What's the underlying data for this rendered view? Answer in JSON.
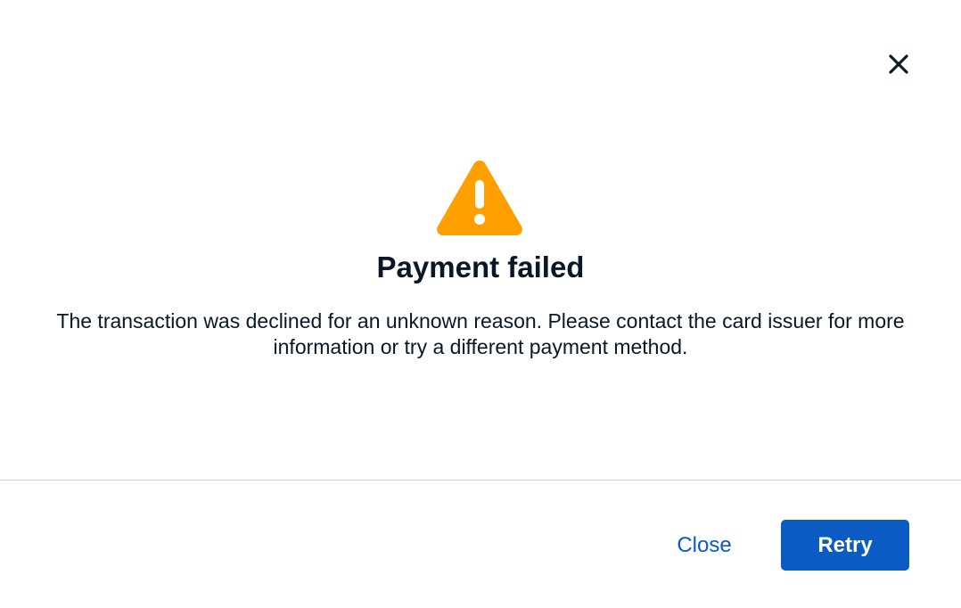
{
  "dialog": {
    "title": "Payment failed",
    "message": "The transaction was declined for an unknown reason. Please contact the card issuer for more information or try a different payment method.",
    "icon": "warning-icon",
    "close_icon": "close-icon"
  },
  "footer": {
    "close_label": "Close",
    "retry_label": "Retry"
  },
  "colors": {
    "accent": "#0a5bc4",
    "warning": "#ffa000",
    "text": "#0b1726",
    "divider": "#c9ccd1"
  }
}
